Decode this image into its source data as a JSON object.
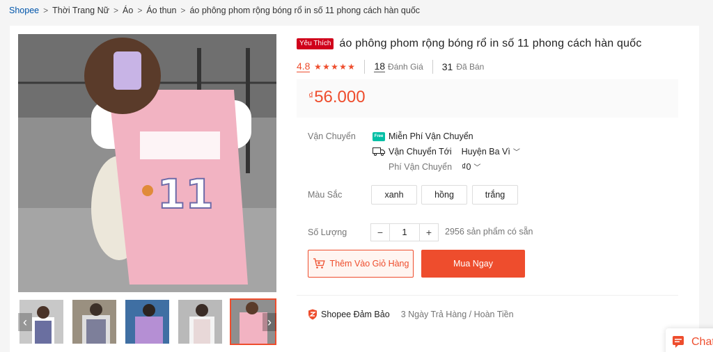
{
  "breadcrumb": {
    "items": [
      "Shopee",
      "Thời Trang Nữ",
      "Áo",
      "Áo thun",
      "áo phông phom rộng bóng rổ in số 11 phong cách hàn quốc"
    ],
    "separator": ">"
  },
  "product": {
    "badge": "Yêu Thích",
    "title": "áo phông phom rộng bóng rổ in số 11 phong cách hàn quốc",
    "rating": "4.8",
    "stars": 5,
    "reviews_count": "18",
    "reviews_label": "Đánh Giá",
    "sold_count": "31",
    "sold_label": "Đã Bán",
    "currency": "₫",
    "price": "56.000"
  },
  "shipping": {
    "label": "Vận Chuyển",
    "free_text": "Miễn Phí Vận Chuyển",
    "free_icon": "Free",
    "to_label": "Vận Chuyển Tới",
    "to_value": "Huyện Ba Vì",
    "fee_label": "Phí Vận Chuyển",
    "fee_value": "₫0"
  },
  "color": {
    "label": "Màu Sắc",
    "options": [
      "xanh",
      "hồng",
      "trắng"
    ]
  },
  "quantity": {
    "label": "Số Lượng",
    "minus": "−",
    "value": "1",
    "plus": "+",
    "stock_text": "2956 sản phẩm có sẵn"
  },
  "actions": {
    "add_to_cart": "Thêm Vào Giỏ Hàng",
    "buy_now": "Mua Ngay"
  },
  "guarantee": {
    "title": "Shopee Đảm Bảo",
    "text": "3 Ngày Trả Hàng / Hoàn Tiền"
  },
  "gallery": {
    "thumbnails": [
      "thumb-1",
      "thumb-2",
      "thumb-3",
      "thumb-4",
      "thumb-5"
    ],
    "prev_arrow": "‹",
    "next_arrow": "›"
  },
  "chat": {
    "label": "Chat"
  },
  "colors": {
    "accent": "#ee4d2d",
    "badge": "#d0011b",
    "link": "#0055aa"
  }
}
